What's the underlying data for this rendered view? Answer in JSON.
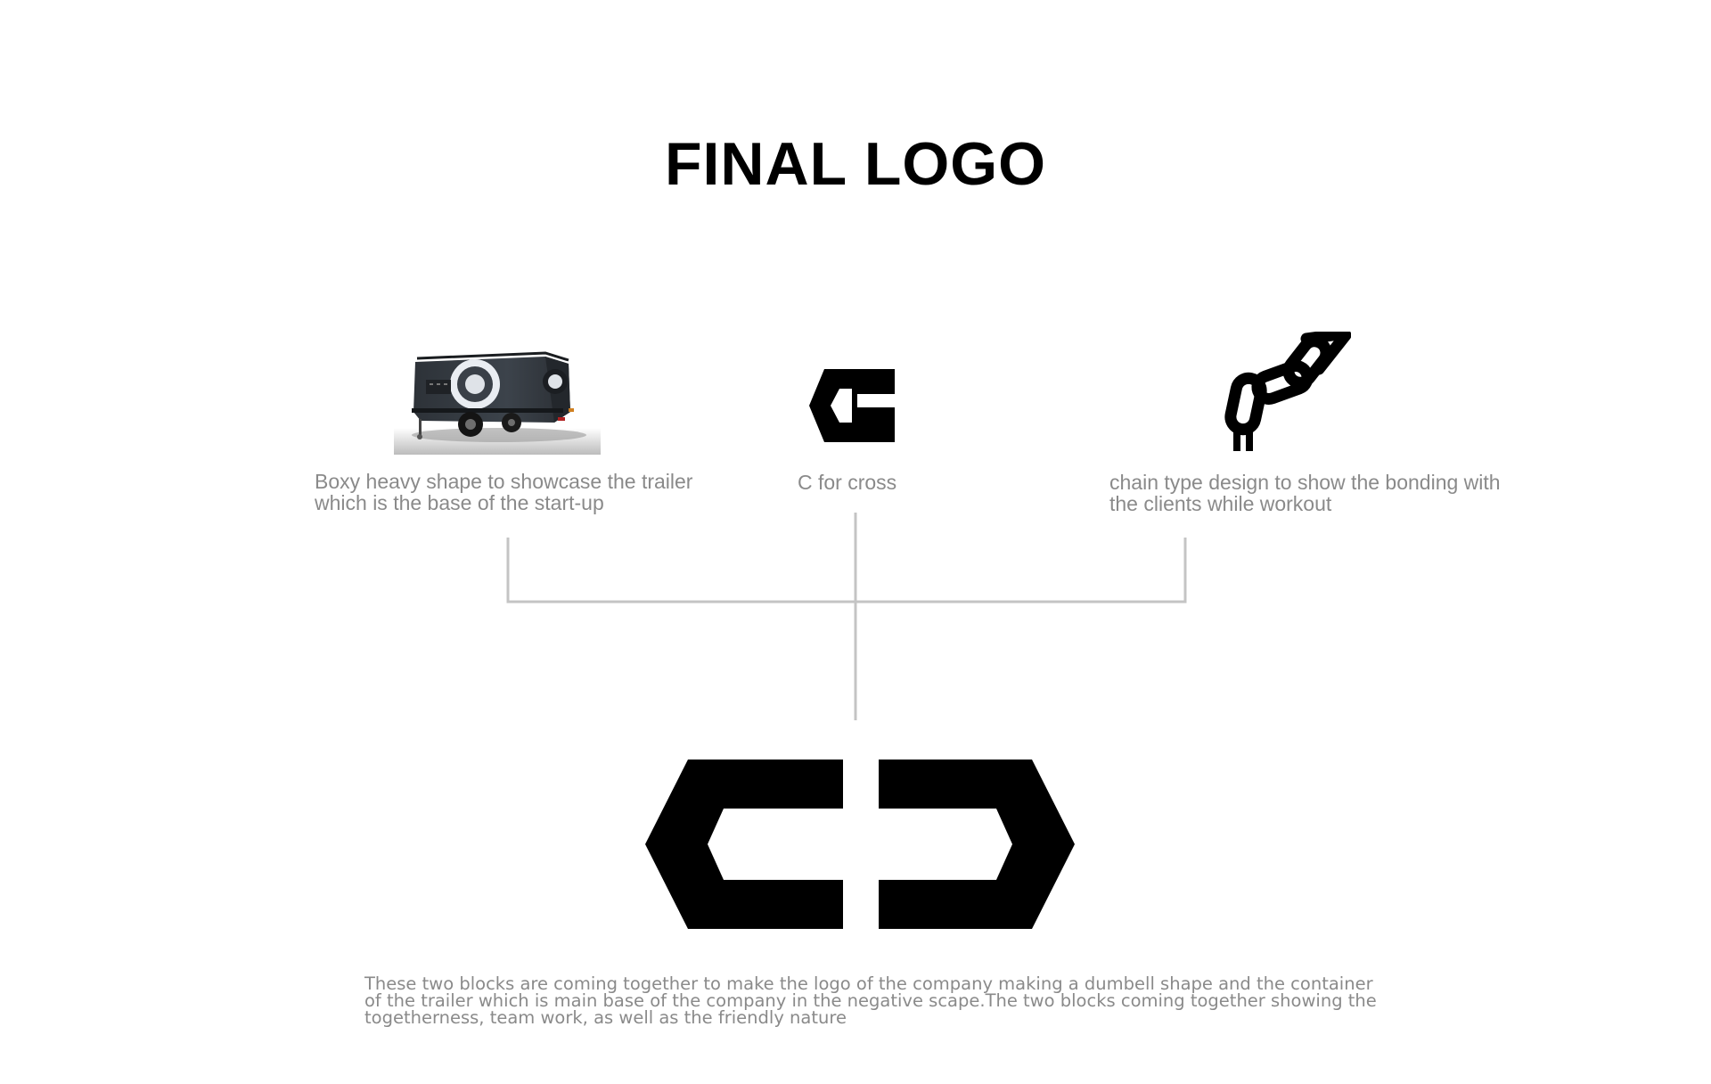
{
  "title": "FINAL LOGO",
  "inspirations": [
    {
      "caption": "Boxy heavy shape to showcase the trailer which is the base of the start-up",
      "image": "trailer-photo"
    },
    {
      "caption": "C for cross",
      "image": "letter-c-mark"
    },
    {
      "caption": "chain type design to show the bonding with the clients while workout",
      "image": "chain-icon"
    }
  ],
  "final_logo": {
    "image": "interlocking-c-blocks-logo",
    "color": "#000000"
  },
  "description": "These two blocks are coming together to make the logo of the company making a dumbell shape and the container of the trailer which is main base of the company in the negative scape.The two blocks coming together showing the togetherness, team work, as well as the friendly nature",
  "colors": {
    "text": "#000000",
    "caption": "#8a8a8a",
    "connector": "#c4c4c4",
    "background": "#ffffff"
  }
}
